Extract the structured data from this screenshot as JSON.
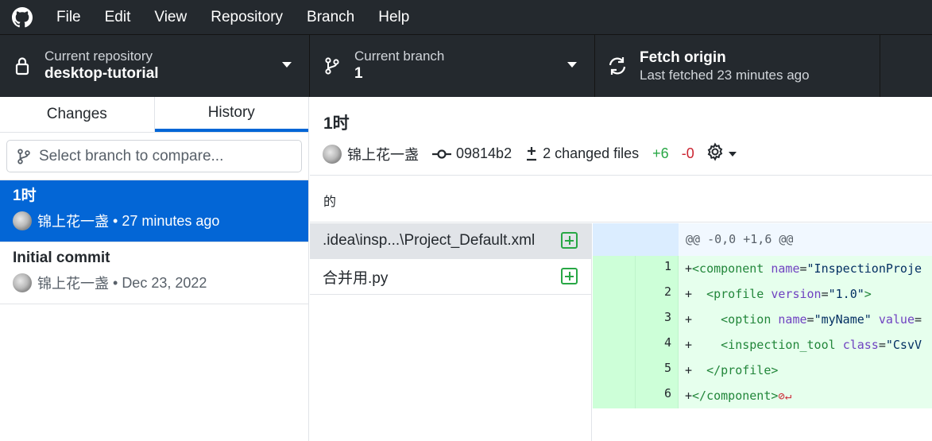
{
  "menu": {
    "items": [
      "File",
      "Edit",
      "View",
      "Repository",
      "Branch",
      "Help"
    ]
  },
  "toolbar": {
    "repo_label": "Current repository",
    "repo_name": "desktop-tutorial",
    "branch_label": "Current branch",
    "branch_name": "1",
    "fetch_title": "Fetch origin",
    "fetch_subtitle": "Last fetched 23 minutes ago"
  },
  "sidebar": {
    "tabs": [
      "Changes",
      "History"
    ],
    "active_tab": "History",
    "compare_placeholder": "Select branch to compare...",
    "commits": [
      {
        "title": "1时",
        "author": "锦上花一盏",
        "time": "27 minutes ago",
        "selected": true
      },
      {
        "title": "Initial commit",
        "author": "锦上花一盏",
        "time": "Dec 23, 2022",
        "selected": false
      }
    ]
  },
  "commit": {
    "title": "1时",
    "author": "锦上花一盏",
    "sha": "09814b2",
    "changed_files": "2 changed files",
    "additions": "+6",
    "deletions": "-0",
    "description": "的"
  },
  "files": [
    {
      "name": ".idea\\insp...\\Project_Default.xml",
      "status": "added",
      "selected": true
    },
    {
      "name": "合并用.py",
      "status": "added",
      "selected": false
    }
  ],
  "diff": {
    "hunk_header": "@@ -0,0 +1,6 @@",
    "line_numbers": [
      "1",
      "2",
      "3",
      "4",
      "5",
      "6"
    ],
    "lines": [
      "+<component name=\"InspectionProje",
      "+  <profile version=\"1.0\">",
      "+    <option name=\"myName\" value=",
      "+    <inspection_tool class=\"CsvV",
      "+  </profile>",
      "+</component>"
    ]
  },
  "colors": {
    "toolbar_bg": "#24292e",
    "accent": "#0366d6",
    "added": "#28a745",
    "removed": "#cb2431",
    "diff_added_bg": "#e6ffed",
    "diff_gutter_bg": "#cdffd8",
    "hunk_bg": "#f1f8ff"
  },
  "icons": {
    "app": "github-mark-icon",
    "repo": "lock-icon",
    "branch": "git-branch-icon",
    "fetch": "sync-icon",
    "commit": "git-commit-icon",
    "diff": "diff-icon",
    "settings": "gear-icon",
    "file_status": "diff-added-icon",
    "no_newline": "no-newline-icon"
  }
}
